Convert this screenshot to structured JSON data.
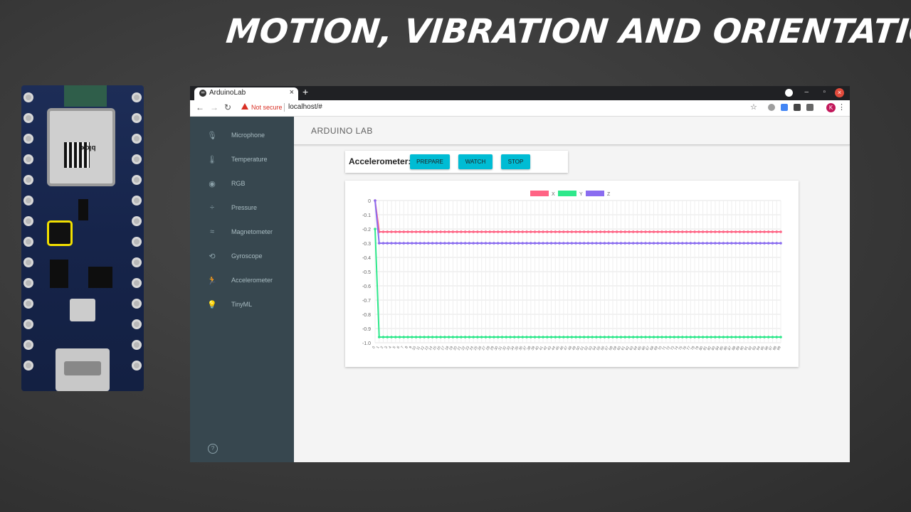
{
  "slide": {
    "title": "Motion, Vibration and Orientation Sensor"
  },
  "board": {
    "module_text": "blox"
  },
  "browser": {
    "tab_title": "ArduinoLab",
    "tab_close": "×",
    "new_tab": "+",
    "not_secure": "Not secure",
    "url": "localhost/#",
    "avatar_letter": "K"
  },
  "app": {
    "title": "ARDUINO LAB",
    "sidebar": [
      {
        "label": "Microphone",
        "icon": "🎙"
      },
      {
        "label": "Temperature",
        "icon": "🌡"
      },
      {
        "label": "RGB",
        "icon": "◉"
      },
      {
        "label": "Pressure",
        "icon": "÷"
      },
      {
        "label": "Magnetometer",
        "icon": "≈"
      },
      {
        "label": "Gyroscope",
        "icon": "⟲"
      },
      {
        "label": "Accelerometer",
        "icon": "🏃"
      },
      {
        "label": "TinyML",
        "icon": "💡"
      }
    ],
    "help_icon": "?",
    "control": {
      "label": "Accelerometer:",
      "buttons": [
        "PREPARE",
        "WATCH",
        "STOP"
      ]
    }
  },
  "chart_data": {
    "type": "line",
    "ylim": [
      -1.0,
      0
    ],
    "yticks": [
      "0",
      "-0.1",
      "-0.2",
      "-0.3",
      "-0.4",
      "-0.5",
      "-0.6",
      "-0.7",
      "-0.8",
      "-0.9",
      "-1.0"
    ],
    "x_count": 100,
    "series": [
      {
        "name": "X",
        "color": "#ff6384",
        "start": 0,
        "values_after_first": -0.22
      },
      {
        "name": "Y",
        "color": "#2ee88b",
        "start": -0.2,
        "values_after_first": -0.96
      },
      {
        "name": "Z",
        "color": "#8a6cf0",
        "start": 0,
        "values_after_first": -0.3
      }
    ],
    "grid": true,
    "legend": "top"
  }
}
